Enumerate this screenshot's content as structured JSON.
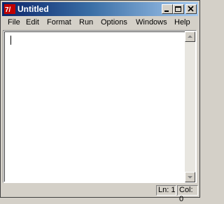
{
  "window": {
    "title": "Untitled",
    "controls": {
      "minimize": "minimize",
      "maximize": "maximize",
      "close": "close"
    }
  },
  "menu": {
    "items": [
      "File",
      "Edit",
      "Format",
      "Run",
      "Options",
      "Windows",
      "Help"
    ]
  },
  "editor": {
    "content": ""
  },
  "status": {
    "line": "Ln: 1",
    "col": "Col: 0"
  },
  "colors": {
    "title_start": "#0a246a",
    "title_end": "#a6caf0",
    "chrome": "#d4d0c8"
  }
}
